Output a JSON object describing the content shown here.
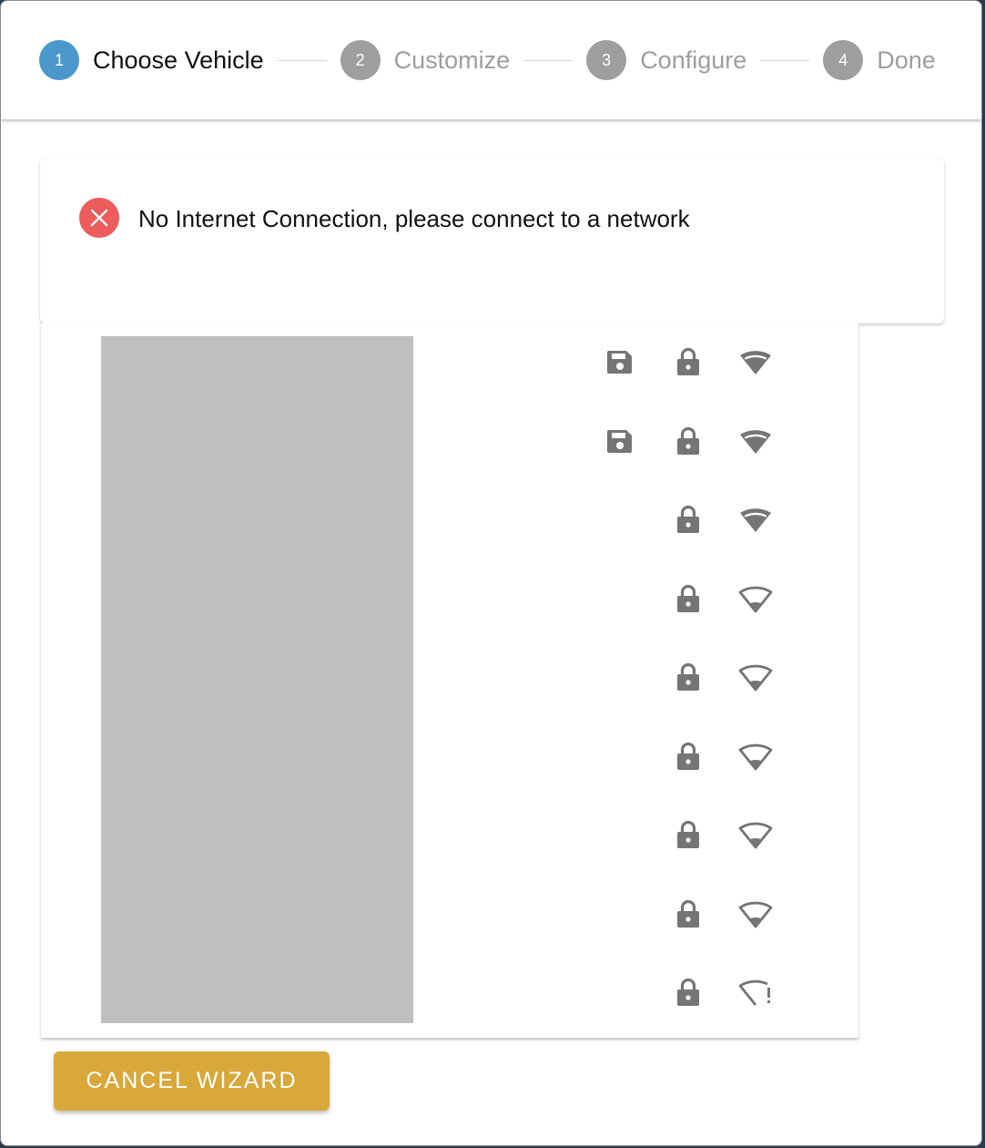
{
  "stepper": {
    "steps": [
      {
        "number": "1",
        "label": "Choose Vehicle",
        "state": "active"
      },
      {
        "number": "2",
        "label": "Customize",
        "state": "inactive"
      },
      {
        "number": "3",
        "label": "Configure",
        "state": "inactive"
      },
      {
        "number": "4",
        "label": "Done",
        "state": "inactive"
      }
    ]
  },
  "alert": {
    "icon": "error-x-circle-icon",
    "message": "No Internet Connection, please connect to a network",
    "color": "#ec5c5b"
  },
  "networks": {
    "name_placeholder": "redacted-network-names",
    "rows": [
      {
        "saved": true,
        "secured": true,
        "signal": "full"
      },
      {
        "saved": true,
        "secured": true,
        "signal": "full"
      },
      {
        "saved": false,
        "secured": true,
        "signal": "full"
      },
      {
        "saved": false,
        "secured": true,
        "signal": "low"
      },
      {
        "saved": false,
        "secured": true,
        "signal": "low"
      },
      {
        "saved": false,
        "secured": true,
        "signal": "low"
      },
      {
        "saved": false,
        "secured": true,
        "signal": "low"
      },
      {
        "saved": false,
        "secured": true,
        "signal": "low"
      },
      {
        "saved": false,
        "secured": true,
        "signal": "alert"
      }
    ]
  },
  "actions": {
    "cancel_label": "CANCEL WIZARD"
  },
  "colors": {
    "step_active": "#4a97cc",
    "step_inactive": "#9e9e9e",
    "icon_gray": "#757575",
    "cancel_button": "#d8a83a",
    "placeholder_gray": "#bfbfbf"
  }
}
